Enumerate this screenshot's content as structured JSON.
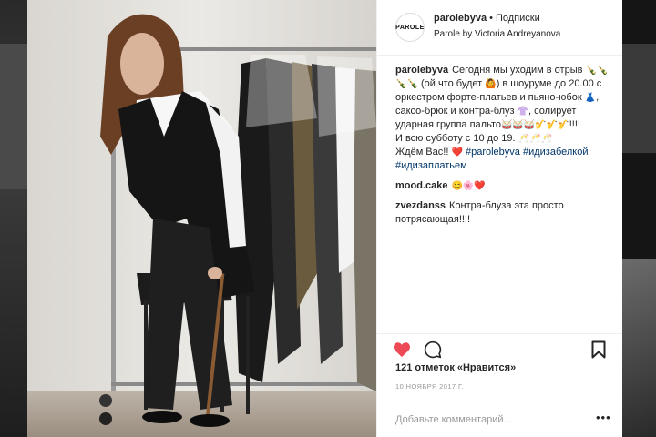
{
  "post": {
    "username": "parolebyva",
    "separator": "•",
    "follow_label": "Подписки",
    "subtitle": "Parole by Victoria Andreyanova",
    "avatar_text": "PAROLE"
  },
  "caption": {
    "username": "parolebyva",
    "text_1": "Сегодня мы уходим в отрыв",
    "emoji_1": "🍾🍾🍾🍾",
    "text_2": "(ой что будет",
    "emoji_2": "🙆",
    "text_3": ") в шоуруме до 20.00 с оркестром форте-платьев и пьяно-юбок",
    "emoji_3": "👗",
    "text_4": ", саксо-брюк и контра-блуз",
    "emoji_4": "👚",
    "text_5": ", солирует ударная группа пальто",
    "emoji_5": "🥁🥁🥁🎷🎷🎷",
    "text_6": "!!!!",
    "text_7": "И всю субботу с 10 до 19.",
    "emoji_6": "🥂🥂🥂",
    "text_8": "Ждём Вас!!",
    "emoji_7": "❤️",
    "tags": [
      "#parolebyva",
      "#идизабелкой",
      "#идизаплатьем"
    ]
  },
  "comments": [
    {
      "username": "mood.cake",
      "text": "😊🌸❤️"
    },
    {
      "username": "zvezdanss",
      "text": "Контра-блуза эта просто потрясающая!!!!"
    }
  ],
  "actions": {
    "like_icon": "heart-icon",
    "comment_icon": "comment-icon",
    "save_icon": "bookmark-icon",
    "liked": true,
    "like_color": "#ed4956"
  },
  "stats": {
    "likes_text": "121 отметок «Нравится»",
    "date_text": "10 НОЯБРЯ 2017 Г."
  },
  "add_comment": {
    "placeholder": "Добавьте комментарий...",
    "more_label": "•••"
  }
}
